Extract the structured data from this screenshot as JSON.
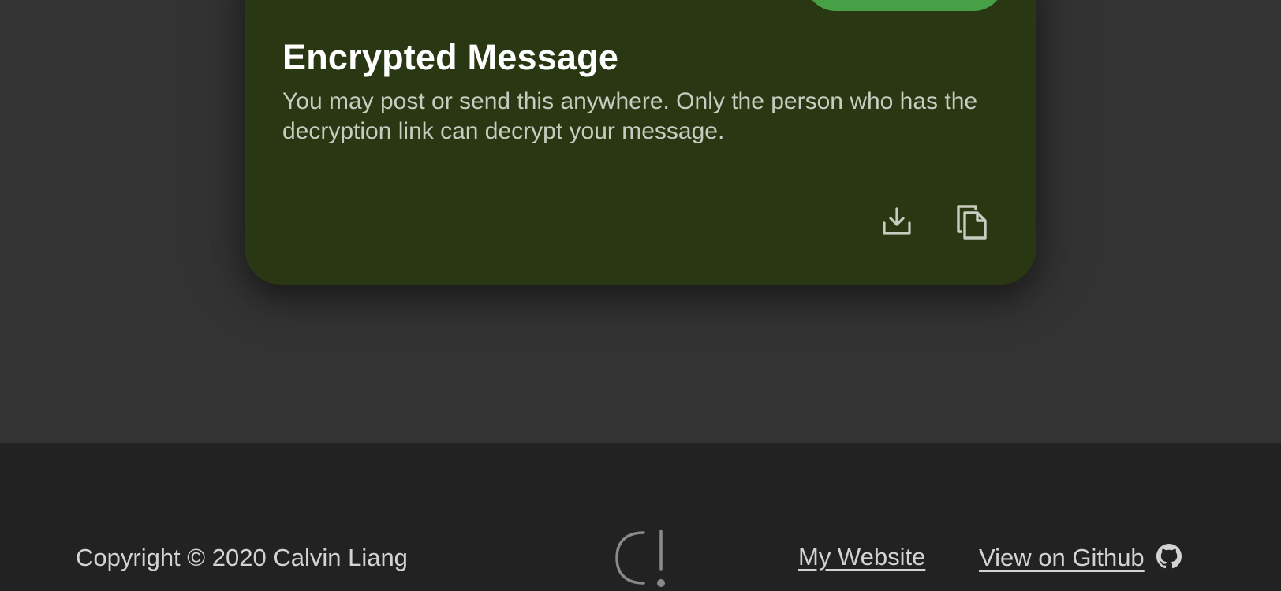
{
  "card": {
    "title": "Encrypted Message",
    "description": "You may post or send this anywhere. Only the person who has the decryption link can decrypt your message.",
    "actions": {
      "download_icon": "download-icon",
      "copy_icon": "copy-icon"
    },
    "colors": {
      "background": "#293813",
      "accent_button": "#46a045",
      "title": "#ffffff",
      "description": "#c7ccc0"
    }
  },
  "footer": {
    "copyright": "Copyright © 2020 Calvin Liang",
    "logo_icon": "calvin-liang-logo",
    "links": {
      "website": "My Website",
      "github": "View on Github",
      "github_icon": "github-icon"
    },
    "colors": {
      "background": "#222222",
      "text": "#d3d3d3"
    }
  },
  "page": {
    "colors": {
      "background": "#333333"
    }
  }
}
